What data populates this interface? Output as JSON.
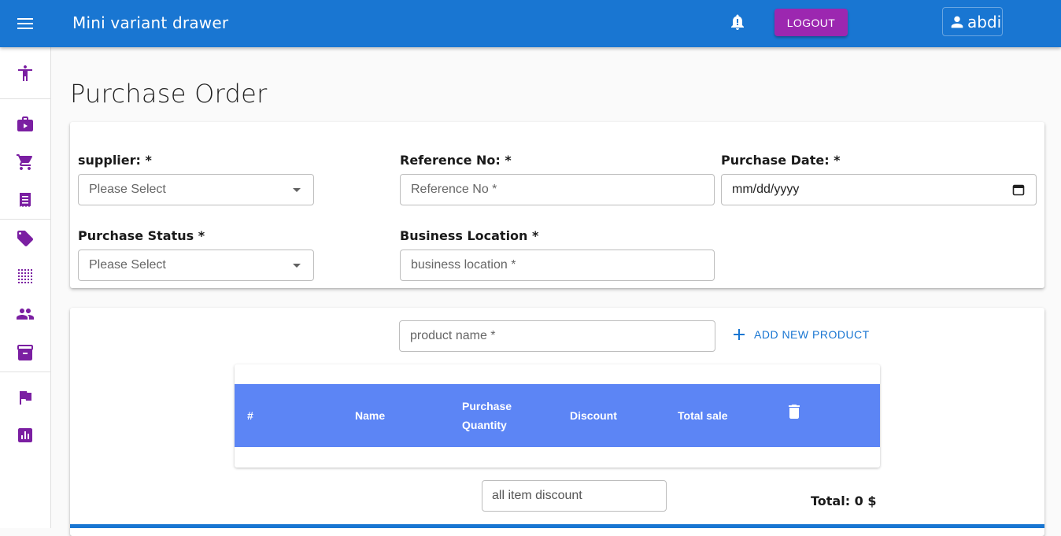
{
  "appbar": {
    "title": "Mini variant drawer",
    "logout_label": "Logout",
    "username": "abdi",
    "color": "#1976d2",
    "logout_color": "#9c27b0"
  },
  "drawer": {
    "icon_color": "#7b1fa2",
    "items": [
      {
        "icon": "accessibility-icon"
      },
      {
        "icon": "work-bag-icon"
      },
      {
        "icon": "cart-icon"
      },
      {
        "icon": "receipt-icon"
      },
      {
        "icon": "tag-icon"
      },
      {
        "icon": "grid-dots-icon"
      },
      {
        "icon": "people-icon"
      },
      {
        "icon": "archive-icon"
      },
      {
        "icon": "flag-icon"
      },
      {
        "icon": "report-chart-icon"
      }
    ]
  },
  "page": {
    "title": "Purchase Order"
  },
  "form": {
    "supplier_label": "supplier: *",
    "supplier_value": "Please Select",
    "reference_label": "Reference No: *",
    "reference_placeholder": "Reference No *",
    "purchase_date_label": "Purchase Date: *",
    "purchase_date_value": "mm/dd/yyyy",
    "purchase_status_label": "Purchase Status *",
    "purchase_status_value": "Please Select",
    "business_location_label": "Business Location *",
    "business_location_placeholder": "business location *"
  },
  "products": {
    "product_name_placeholder": "product name *",
    "add_new_label": "Add New Product",
    "table": {
      "header_color": "#5c85f5",
      "columns": [
        "#",
        "Name",
        "Purchase",
        "Quantity",
        "Discount",
        "Total sale"
      ],
      "rows": []
    },
    "all_item_discount_placeholder": "all item discount",
    "total_label": "Total: 0 $"
  }
}
